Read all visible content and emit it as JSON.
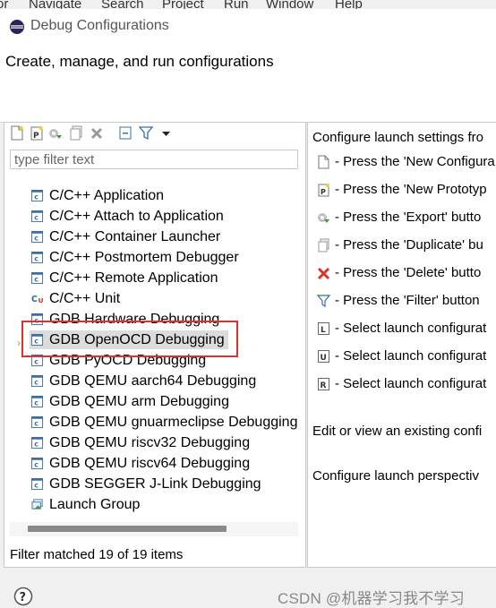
{
  "background_menu": [
    "or",
    "Navigate",
    "Search",
    "Project",
    "Run",
    "Window",
    "Help"
  ],
  "dialog": {
    "title": "Debug Configurations",
    "header_message": "Create, manage, and run configurations"
  },
  "toolbar": {
    "buttons": [
      "new-configuration-icon",
      "new-prototype-icon",
      "export-icon",
      "duplicate-icon",
      "delete-icon",
      "collapse-all-icon",
      "filter-icon",
      "dropdown-arrow-icon"
    ]
  },
  "filter": {
    "placeholder": "type filter text",
    "value": ""
  },
  "tree": {
    "items": [
      {
        "label": "C/C++ Application",
        "icon": "c-launch-icon"
      },
      {
        "label": "C/C++ Attach to Application",
        "icon": "c-launch-icon"
      },
      {
        "label": "C/C++ Container Launcher",
        "icon": "c-launch-icon"
      },
      {
        "label": "C/C++ Postmortem Debugger",
        "icon": "c-launch-icon"
      },
      {
        "label": "C/C++ Remote Application",
        "icon": "c-launch-icon"
      },
      {
        "label": "C/C++ Unit",
        "icon": "cunit-icon"
      },
      {
        "label": "GDB Hardware Debugging",
        "icon": "c-launch-icon"
      },
      {
        "label": "GDB OpenOCD Debugging",
        "icon": "c-launch-icon",
        "selected": true
      },
      {
        "label": "GDB PyOCD Debugging",
        "icon": "c-launch-icon"
      },
      {
        "label": "GDB QEMU aarch64 Debugging",
        "icon": "c-launch-icon"
      },
      {
        "label": "GDB QEMU arm Debugging",
        "icon": "c-launch-icon"
      },
      {
        "label": "GDB QEMU gnuarmeclipse Debugging",
        "icon": "c-launch-icon"
      },
      {
        "label": "GDB QEMU riscv32 Debugging",
        "icon": "c-launch-icon"
      },
      {
        "label": "GDB QEMU riscv64 Debugging",
        "icon": "c-launch-icon"
      },
      {
        "label": "GDB SEGGER J-Link Debugging",
        "icon": "c-launch-icon"
      },
      {
        "label": "Launch Group",
        "icon": "launch-group-icon"
      }
    ]
  },
  "status": "Filter matched 19 of 19 items",
  "right_pane": {
    "intro": "Configure launch settings fro",
    "items": [
      {
        "icon": "new-configuration-icon",
        "text": "- Press the 'New Configura"
      },
      {
        "icon": "new-prototype-icon",
        "text": "- Press the 'New Prototyp"
      },
      {
        "icon": "export-icon",
        "text": "- Press the 'Export' butto"
      },
      {
        "icon": "duplicate-icon",
        "text": "- Press the 'Duplicate' bu"
      },
      {
        "icon": "delete-icon",
        "text": "- Press the 'Delete' butto"
      },
      {
        "icon": "filter-icon",
        "text": "- Press the 'Filter' button"
      },
      {
        "icon": "link-prototype-icon",
        "text": "- Select launch configurat"
      },
      {
        "icon": "unlink-prototype-icon",
        "text": "- Select launch configurat"
      },
      {
        "icon": "reset-prototype-icon",
        "text": "- Select launch configurat"
      }
    ],
    "edit_line": "Edit or view an existing confi",
    "perspective_line": "Configure launch perspectiv"
  },
  "watermark": "CSDN @机器学习我不学习",
  "colors": {
    "highlight": "#e0302e",
    "selection": "#dcdcdc"
  }
}
